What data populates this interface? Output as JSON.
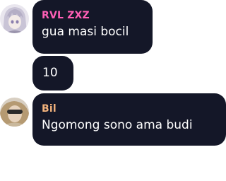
{
  "messages": [
    {
      "username": "RVL ZXZ",
      "username_color": "#ff5fb6",
      "text": "gua masi bocil",
      "avatar_icon": "anime-girl-avatar"
    },
    {
      "username": "",
      "text": "10"
    },
    {
      "username": "Bil",
      "username_color": "#f2b27c",
      "text": "Ngomong sono ama budi",
      "avatar_icon": "person-photo-avatar"
    }
  ],
  "colors": {
    "bubble_bg": "#141728",
    "message_text": "#ffffff",
    "page_bg": "#ffffff"
  }
}
